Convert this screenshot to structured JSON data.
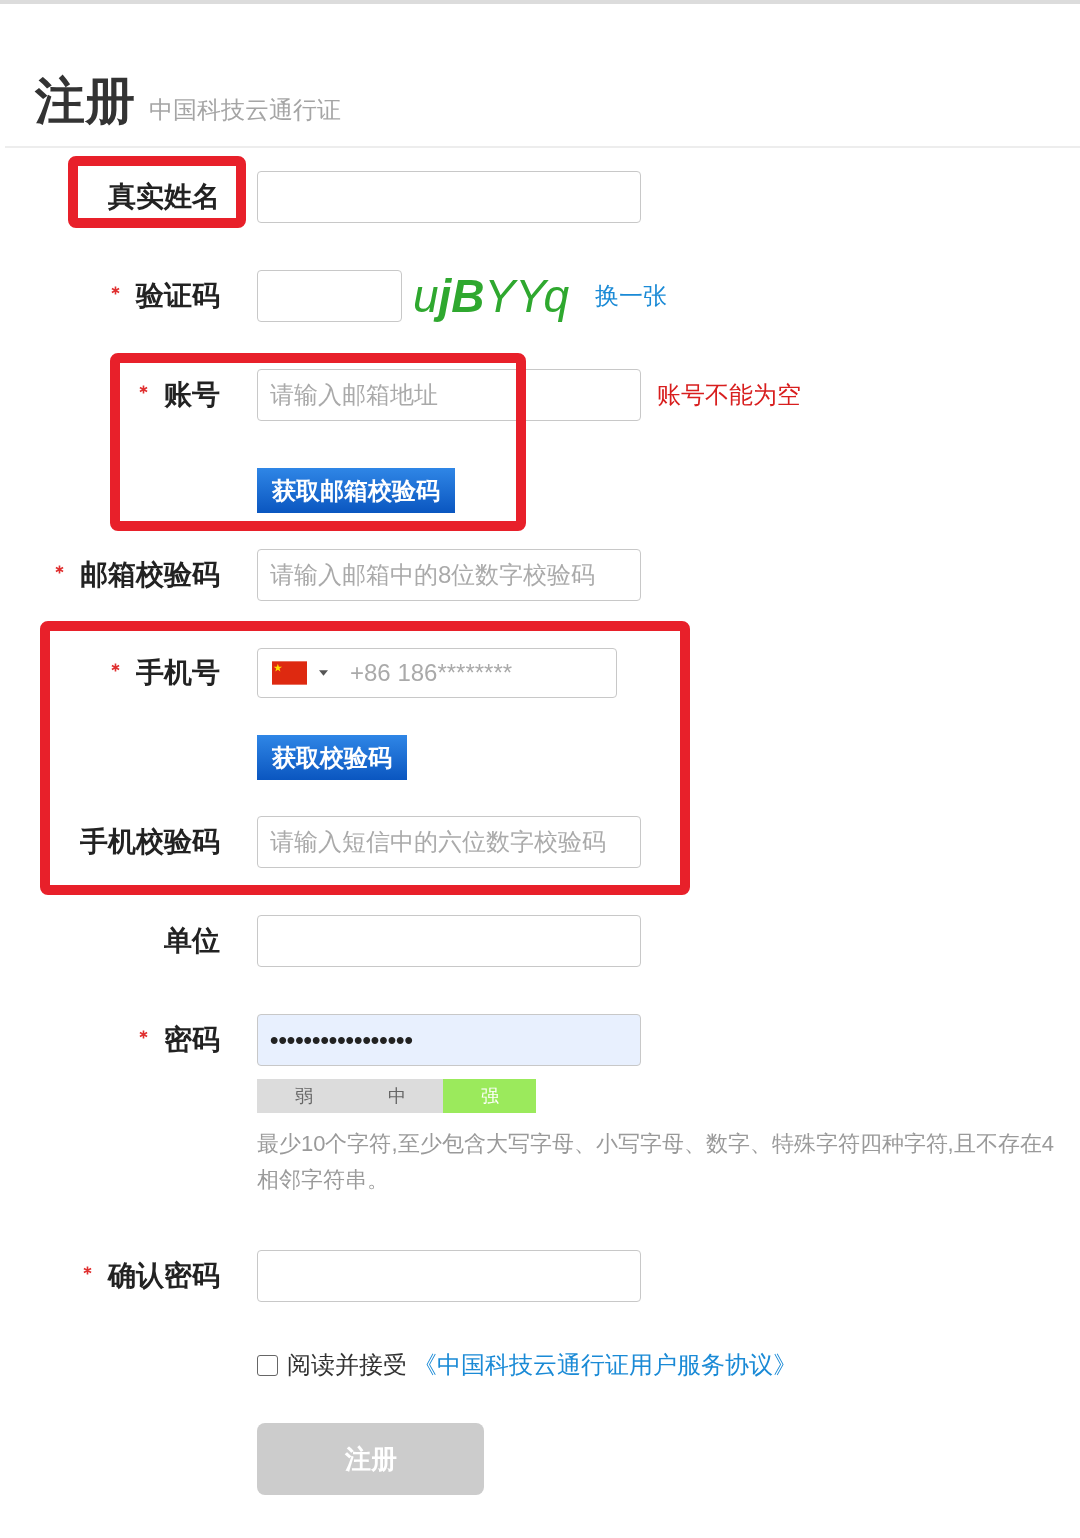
{
  "header": {
    "title": "注册",
    "subtitle": "中国科技云通行证"
  },
  "form": {
    "rows": [
      {
        "kind": "text",
        "label": "真实姓名",
        "required": false,
        "highlight": {
          "kind": "label"
        }
      },
      {
        "kind": "captcha",
        "label": "验证码",
        "required": true,
        "captcha": "u**jB**YYq",
        "refresh_link": "换一张"
      },
      {
        "kind": "email",
        "label": "账号",
        "required": true,
        "placeholder": "请输入邮箱地址",
        "error": "账号不能为空",
        "button": "获取邮箱校验码",
        "highlight": {
          "kind": "partial"
        }
      },
      {
        "kind": "text",
        "label": "邮箱校验码",
        "required": true,
        "placeholder": "请输入邮箱中的8位数字校验码"
      },
      {
        "kind": "phone",
        "label": "手机号",
        "required": true,
        "placeholder": "+86 186********",
        "button": "获取校验码",
        "highlight": {
          "kind": "full"
        }
      },
      {
        "kind": "text",
        "label": "手机校验码",
        "required": false,
        "placeholder": "请输入短信中的六位数字校验码",
        "highlight": {
          "kind": "full"
        }
      },
      {
        "kind": "text",
        "label": "单位",
        "required": false
      },
      {
        "kind": "password",
        "label": "密码",
        "required": true,
        "value": "•••••••••••••••••",
        "autofilled": true,
        "strength": [
          {
            "label": "弱",
            "selected": false
          },
          {
            "label": "中",
            "selected": false
          },
          {
            "label": "强",
            "selected": true
          }
        ],
        "hint": "最少10个字符,至少包含大写字母、小写字母、数字、特殊字符四种字符,且不存在4\n相邻字符串。"
      },
      {
        "kind": "password",
        "label": "确认密码",
        "required": true,
        "autofilled": false
      }
    ]
  },
  "agreement": {
    "checked": false,
    "text": "阅读并接受",
    "link": "《中国科技云通行证用户服务协议》"
  },
  "submit": {
    "label": "注册",
    "disabled": true
  }
}
